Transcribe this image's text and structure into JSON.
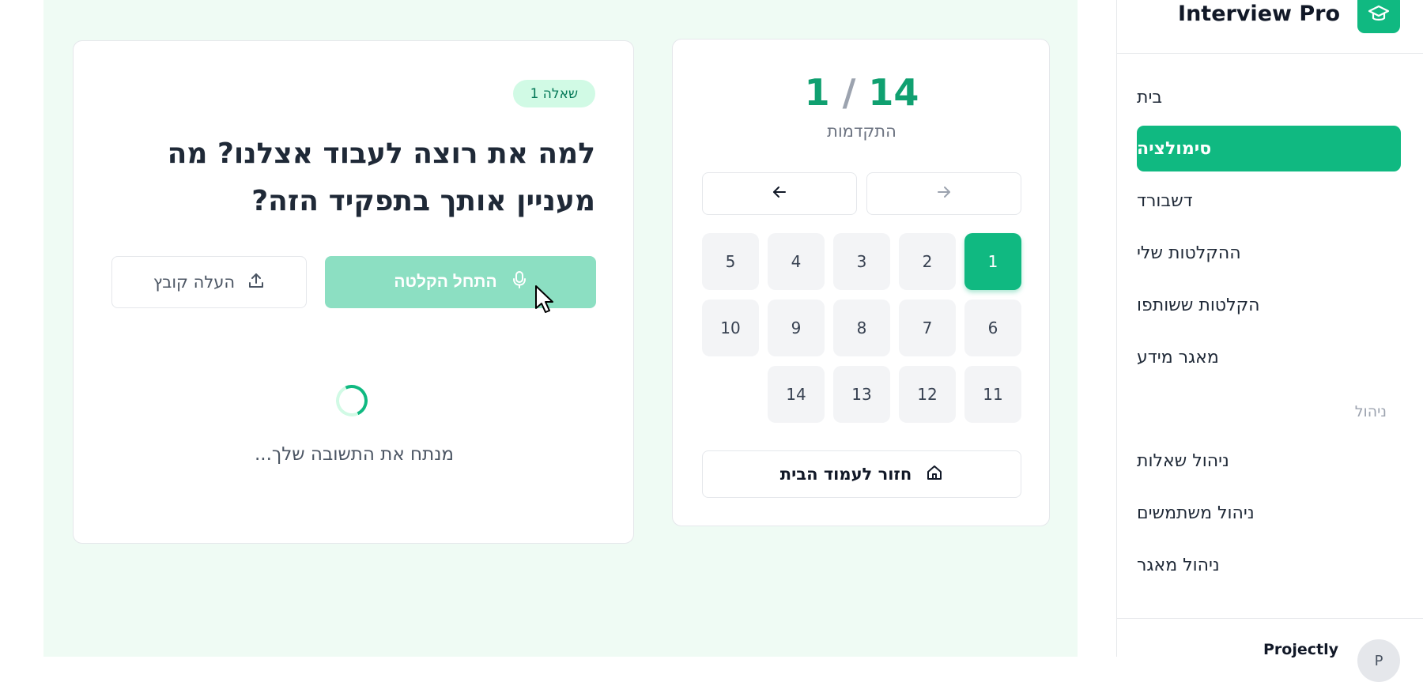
{
  "brand": {
    "title": "Interview Pro",
    "logo_icon": "graduation-cap-icon",
    "accent_color": "#10b981"
  },
  "sidebar": {
    "items": [
      {
        "label": "בית",
        "active": false
      },
      {
        "label": "סימולציה",
        "active": true
      },
      {
        "label": "דשבורד",
        "active": false
      },
      {
        "label": "ההקלטות שלי",
        "active": false
      },
      {
        "label": "הקלטות ששותפו",
        "active": false
      },
      {
        "label": "מאגר מידע",
        "active": false
      }
    ],
    "section_label": "ניהול",
    "admin_items": [
      {
        "label": "ניהול שאלות"
      },
      {
        "label": "ניהול משתמשים"
      },
      {
        "label": "ניהול מאגר"
      }
    ],
    "footer": {
      "name": "Projectly",
      "avatar_initial": "P"
    }
  },
  "question": {
    "badge": "שאלה 1",
    "text": "למה את רוצה לעבוד אצלנו? מה מעניין אותך בתפקיד הזה?",
    "record_label": "התחל הקלטה",
    "upload_label": "העלה קובץ",
    "analyzing_text": "מנתח את התשובה שלך..."
  },
  "progress": {
    "current": "1",
    "separator": "/",
    "total": "14",
    "label": "התקדמות",
    "questions": [
      "1",
      "2",
      "3",
      "4",
      "5",
      "6",
      "7",
      "8",
      "9",
      "10",
      "11",
      "12",
      "13",
      "14"
    ],
    "active_question": "1",
    "home_label": "חזור לעמוד הבית"
  }
}
